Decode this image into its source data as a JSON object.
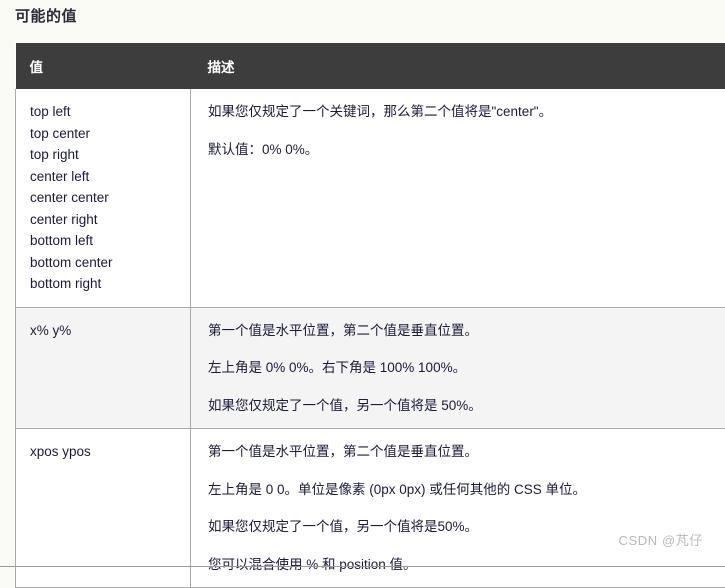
{
  "page": {
    "title": "可能的值",
    "watermark": "CSDN @芃仔"
  },
  "table": {
    "headers": {
      "value": "值",
      "description": "描述"
    },
    "rows": [
      {
        "value_items": [
          "top left",
          "top center",
          "top right",
          "center left",
          "center center",
          "center right",
          "bottom left",
          "bottom center",
          "bottom right"
        ],
        "description_paragraphs": [
          "如果您仅规定了一个关键词，那么第二个值将是\"center\"。",
          "默认值：0% 0%。"
        ]
      },
      {
        "value_text": "x% y%",
        "description_paragraphs": [
          "第一个值是水平位置，第二个值是垂直位置。",
          "左上角是 0% 0%。右下角是 100% 100%。",
          "如果您仅规定了一个值，另一个值将是 50%。"
        ]
      },
      {
        "value_text": "xpos ypos",
        "description_paragraphs": [
          "第一个值是水平位置，第二个值是垂直位置。",
          "左上角是 0 0。单位是像素 (0px 0px) 或任何其他的 CSS 单位。",
          "如果您仅规定了一个值，另一个值将是50%。",
          "您可以混合使用 % 和 position 值。"
        ]
      }
    ]
  },
  "colors": {
    "header_background": "#3d3d3d",
    "page_background": "#fbfbf6",
    "row_alt_background": "#f4f4f4",
    "border": "#aaaaaa",
    "text": "#1a1a3a",
    "watermark": "#b9b9b9"
  }
}
